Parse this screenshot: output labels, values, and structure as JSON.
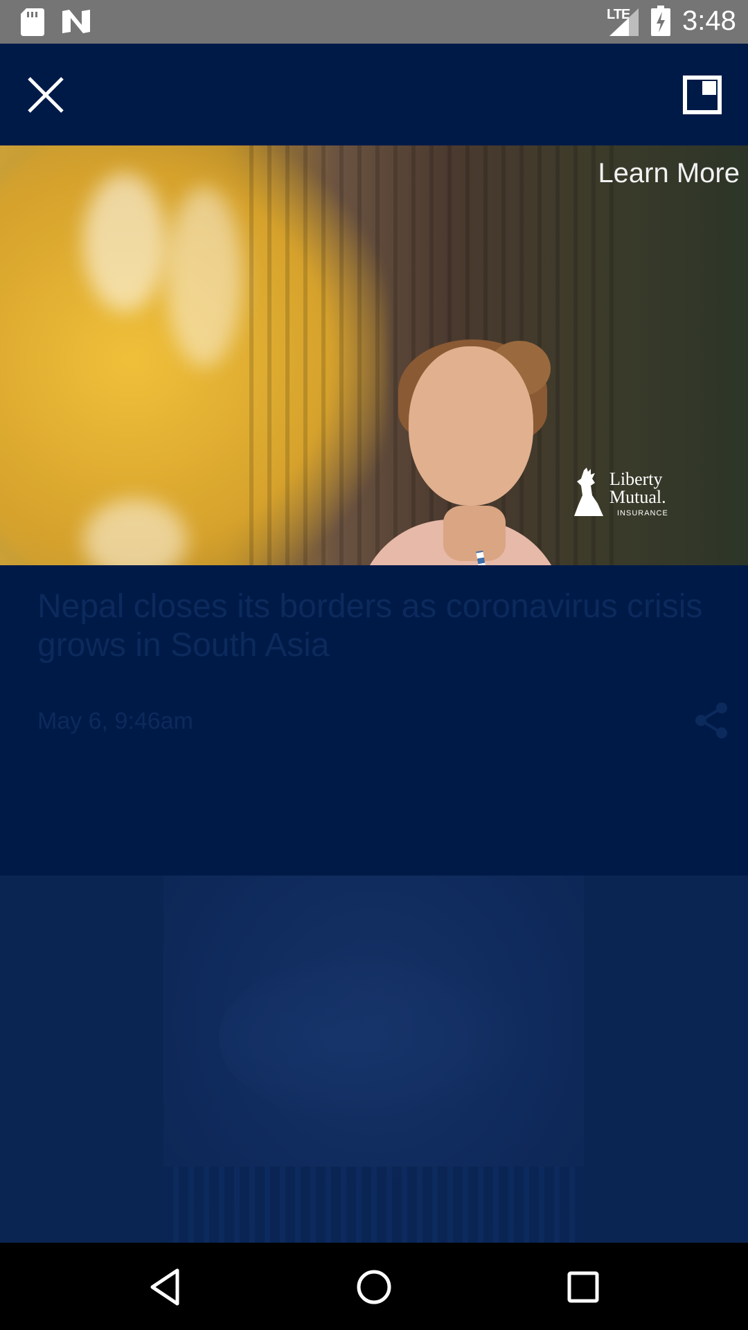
{
  "status_bar": {
    "network": "LTE",
    "time": "3:48"
  },
  "video_ad": {
    "learn_more": "Learn More",
    "sponsor": {
      "line1": "Liberty",
      "line2": "Mutual.",
      "line3": "INSURANCE"
    }
  },
  "article": {
    "headline": "Nepal closes its borders as coronavirus crisis grows in South Asia",
    "date": "May 6, 9:46am"
  },
  "icons": {
    "close": "close-icon",
    "pip": "picture-in-picture-icon",
    "share": "share-icon",
    "back": "back-triangle-icon",
    "home": "home-circle-icon",
    "recents": "recents-square-icon"
  },
  "colors": {
    "background": "#001a48",
    "status_bar": "#757575",
    "muted_text": "#0c2a5c",
    "nav_bar": "#000000"
  }
}
